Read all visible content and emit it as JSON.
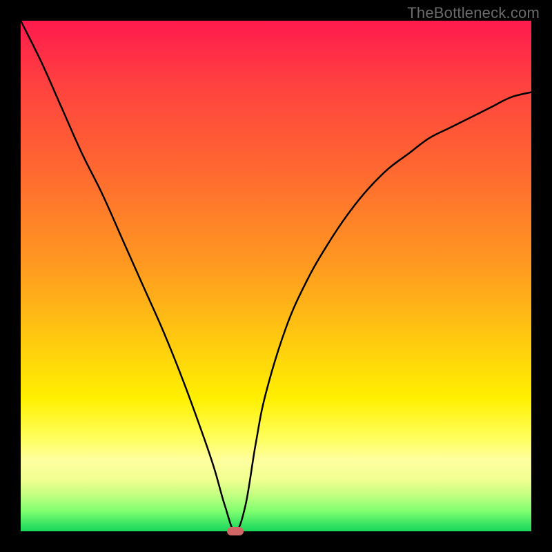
{
  "watermark": "TheBottleneck.com",
  "chart_data": {
    "type": "line",
    "title": "",
    "xlabel": "",
    "ylabel": "",
    "xlim": [
      0,
      100
    ],
    "ylim": [
      0,
      100
    ],
    "grid": false,
    "legend": false,
    "x": [
      0,
      4,
      8,
      12,
      16,
      20,
      24,
      28,
      32,
      36,
      38,
      40,
      42,
      44,
      46,
      48,
      52,
      56,
      60,
      64,
      68,
      72,
      76,
      80,
      84,
      88,
      92,
      96,
      100
    ],
    "values": [
      100,
      92,
      83,
      74,
      66,
      57,
      48,
      39,
      29,
      18,
      12,
      5,
      0,
      5,
      17,
      27,
      40,
      49,
      56,
      62,
      67,
      71,
      74,
      77,
      79,
      81,
      83,
      85,
      86
    ],
    "minimum_marker": {
      "x": 42,
      "y": 0,
      "color": "#d06666"
    },
    "background_gradient": {
      "top": "#ff1a4d",
      "upper_mid": "#ff9a20",
      "mid": "#fff000",
      "lower_mid": "#ffffa0",
      "bottom": "#1bd85a"
    },
    "frame_color": "#000000"
  }
}
